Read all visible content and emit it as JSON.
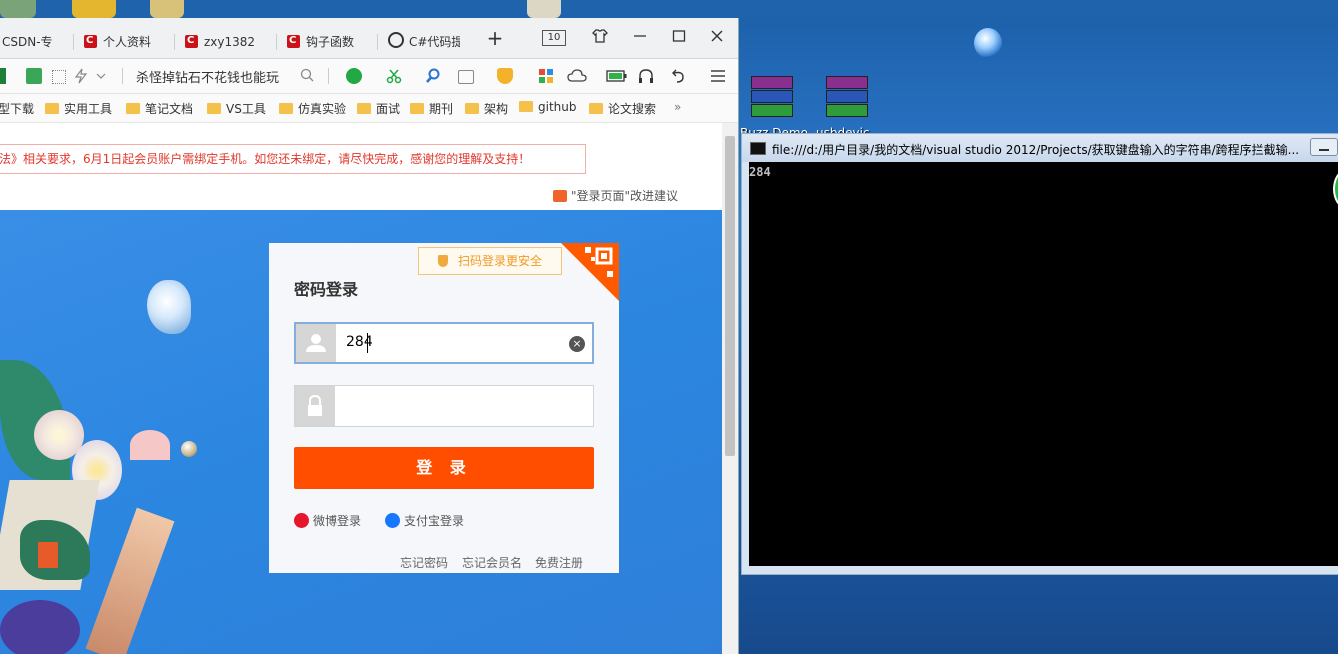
{
  "browser": {
    "tabs": [
      {
        "label": "CSDN-专"
      },
      {
        "label": "个人资料"
      },
      {
        "label": "zxy1382"
      },
      {
        "label": "钩子函数"
      },
      {
        "label": "C#代码提"
      }
    ],
    "tab_count": "10",
    "new_tab_symbol": "+",
    "search_text": "杀怪掉钻石不花钱也能玩",
    "bookmarks": [
      "型下载",
      "实用工具",
      "笔记文档",
      "VS工具",
      "仿真实验",
      "面试",
      "期刊",
      "架构",
      "github",
      "论文搜索"
    ],
    "bookmarks_more": "»",
    "notice": "法》相关要求，6月1日起会员账户需绑定手机。如您还未绑定，请尽快完成，感谢您的理解及支持！",
    "suggest": "\"登录页面\"改进建议"
  },
  "login": {
    "qr_badge": "扫码登录更安全",
    "title": "密码登录",
    "username_value": "284",
    "clear_symbol": "×",
    "submit_label": "登 录",
    "weibo_label": "微博登录",
    "alipay_label": "支付宝登录",
    "links": [
      "忘记密码",
      "忘记会员名",
      "免费注册"
    ]
  },
  "desktop": {
    "labels": [
      "Buzz Demo",
      "usbdevic"
    ]
  },
  "console": {
    "title": "file:///d:/用户目录/我的文档/visual studio 2012/Projects/获取键盘输入的字符串/跨程序拦截输...",
    "output": "284"
  },
  "colors": {
    "accent": "#ff4e00",
    "banner": "#2b86e0",
    "notice": "#e0372c"
  }
}
